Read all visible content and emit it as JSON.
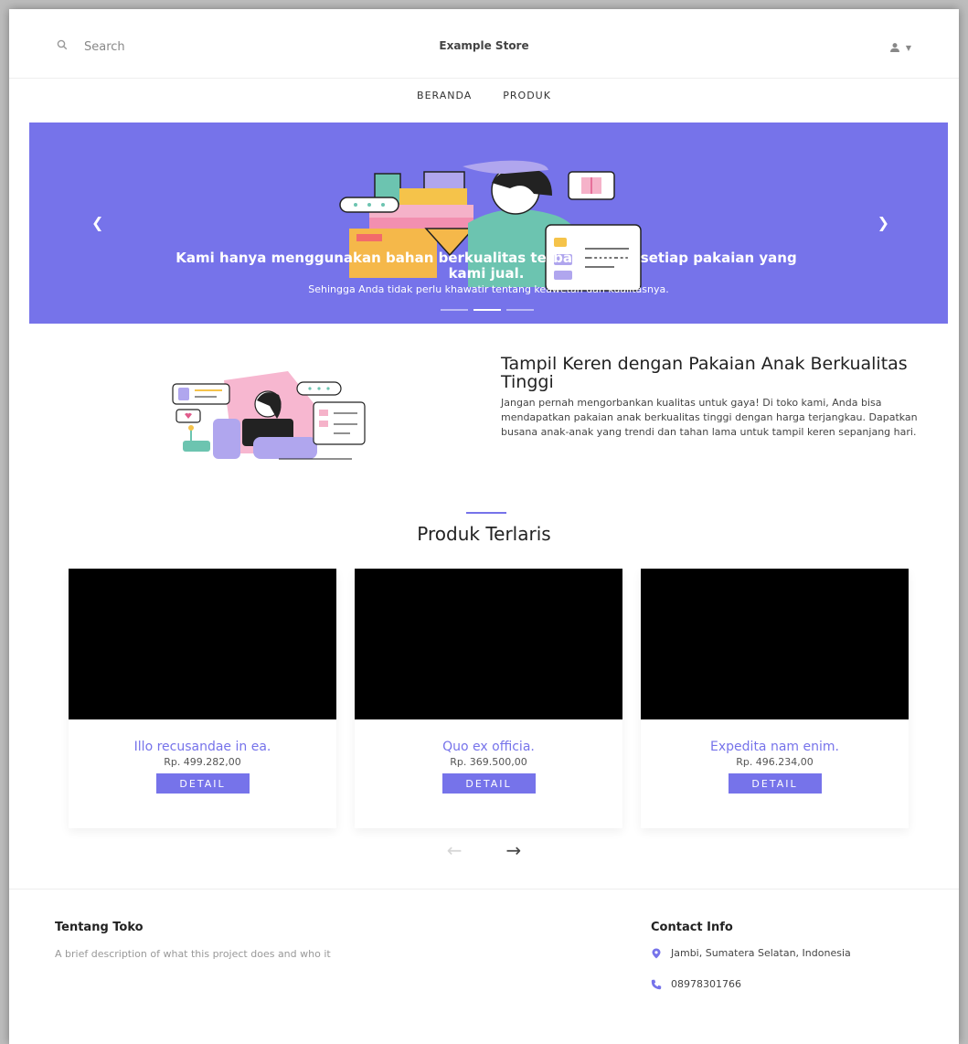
{
  "header": {
    "search_placeholder": "Search",
    "brand": "Example Store"
  },
  "nav": [
    {
      "label": "BERANDA"
    },
    {
      "label": "PRODUK"
    }
  ],
  "hero": {
    "title": "Kami hanya menggunakan bahan berkualitas terbaik untuk setiap pakaian yang kami jual.",
    "subtitle": "Sehingga Anda tidak perlu khawatir tentang keawetan dan kualitasnya.",
    "prev_icon": "chevron-left-icon",
    "next_icon": "chevron-right-icon",
    "background_color": "#7673ea",
    "indicators_count": 3,
    "active_indicator": 2
  },
  "about": {
    "title": "Tampil Keren dengan Pakaian Anak Berkualitas Tinggi",
    "body": "Jangan pernah mengorbankan kualitas untuk gaya! Di toko kami, Anda bisa mendapatkan pakaian anak berkualitas tinggi dengan harga terjangkau. Dapatkan busana anak-anak yang trendi dan tahan lama untuk tampil keren sepanjang hari."
  },
  "products": {
    "title": "Produk Terlaris",
    "items": [
      {
        "name": "Illo recusandae in ea.",
        "price": "Rp. 499.282,00",
        "button": "DETAIL"
      },
      {
        "name": "Quo ex officia.",
        "price": "Rp. 369.500,00",
        "button": "DETAIL"
      },
      {
        "name": "Expedita nam enim.",
        "price": "Rp. 496.234,00",
        "button": "DETAIL"
      }
    ],
    "prev_label": "←",
    "next_label": "→"
  },
  "footer": {
    "about_title": "Tentang Toko",
    "about_text": "A brief description of what this project does and who it",
    "contact_title": "Contact Info",
    "address": "Jambi, Sumatera Selatan, Indonesia",
    "phone": "08978301766"
  },
  "colors": {
    "accent": "#7673ea"
  }
}
